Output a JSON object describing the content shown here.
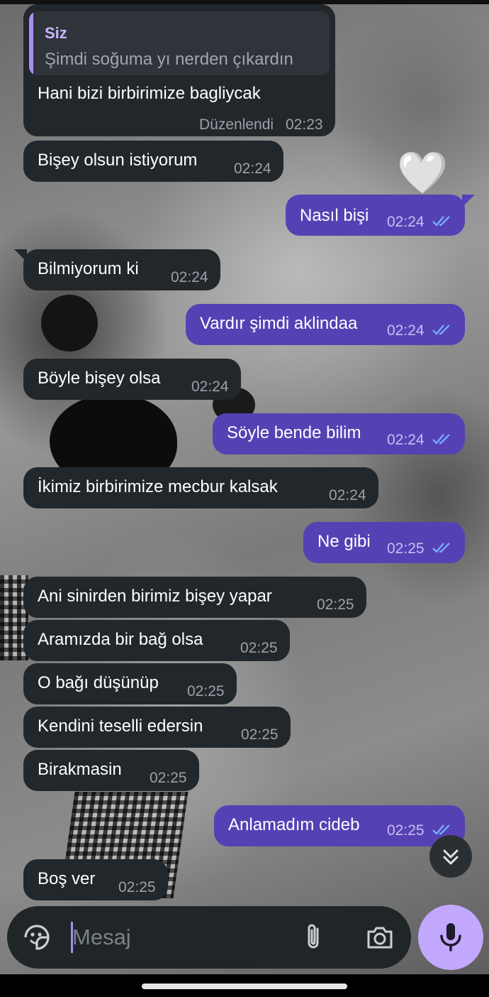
{
  "colors": {
    "incoming_bubble": "#22272b",
    "outgoing_bubble": "#5641b4",
    "accent": "#c3a8ff",
    "read_checks": "#78b4ff"
  },
  "messages": [
    {
      "direction": "in",
      "reply_to": {
        "name": "Siz",
        "text": "Şimdi soğuma yı nerden çıkardın"
      },
      "text": "Hani bizi birbirimize bagliycak",
      "edited": "Düzenlendi",
      "time": "02:23"
    },
    {
      "direction": "in",
      "text": "Bişey olsun istiyorum",
      "time": "02:24"
    },
    {
      "direction": "out",
      "text": "Nasıl bişi",
      "time": "02:24",
      "status": "read"
    },
    {
      "direction": "in",
      "text": "Bilmiyorum ki",
      "time": "02:24"
    },
    {
      "direction": "out",
      "text": "Vardır şimdi aklindaa",
      "time": "02:24",
      "status": "read"
    },
    {
      "direction": "in",
      "text": "Böyle bişey olsa",
      "time": "02:24"
    },
    {
      "direction": "out",
      "text": "Söyle bende bilim",
      "time": "02:24",
      "status": "read"
    },
    {
      "direction": "in",
      "text": "İkimiz birbirimize mecbur kalsak",
      "time": "02:24"
    },
    {
      "direction": "out",
      "text": "Ne gibi",
      "time": "02:25",
      "status": "read"
    },
    {
      "direction": "in",
      "text": "Ani sinirden birimiz bişey yapar",
      "time": "02:25"
    },
    {
      "direction": "in",
      "text": "Aramızda bir bağ olsa",
      "time": "02:25"
    },
    {
      "direction": "in",
      "text": "O bağı düşünüp",
      "time": "02:25"
    },
    {
      "direction": "in",
      "text": "Kendini teselli edersin",
      "time": "02:25"
    },
    {
      "direction": "in",
      "text": "Birakmasin",
      "time": "02:25"
    },
    {
      "direction": "out",
      "text": "Anlamadım cideb",
      "time": "02:25",
      "status": "read"
    },
    {
      "direction": "in",
      "text": "Boş ver",
      "time": "02:25"
    }
  ],
  "reaction": {
    "emoji": "🤍"
  },
  "composer": {
    "placeholder": "Mesaj",
    "icons": {
      "sticker": "sticker-icon",
      "attach": "paperclip-icon",
      "camera": "camera-icon",
      "mic": "microphone-icon"
    }
  },
  "scroll_down": {
    "icon": "double-chevron-down-icon"
  }
}
